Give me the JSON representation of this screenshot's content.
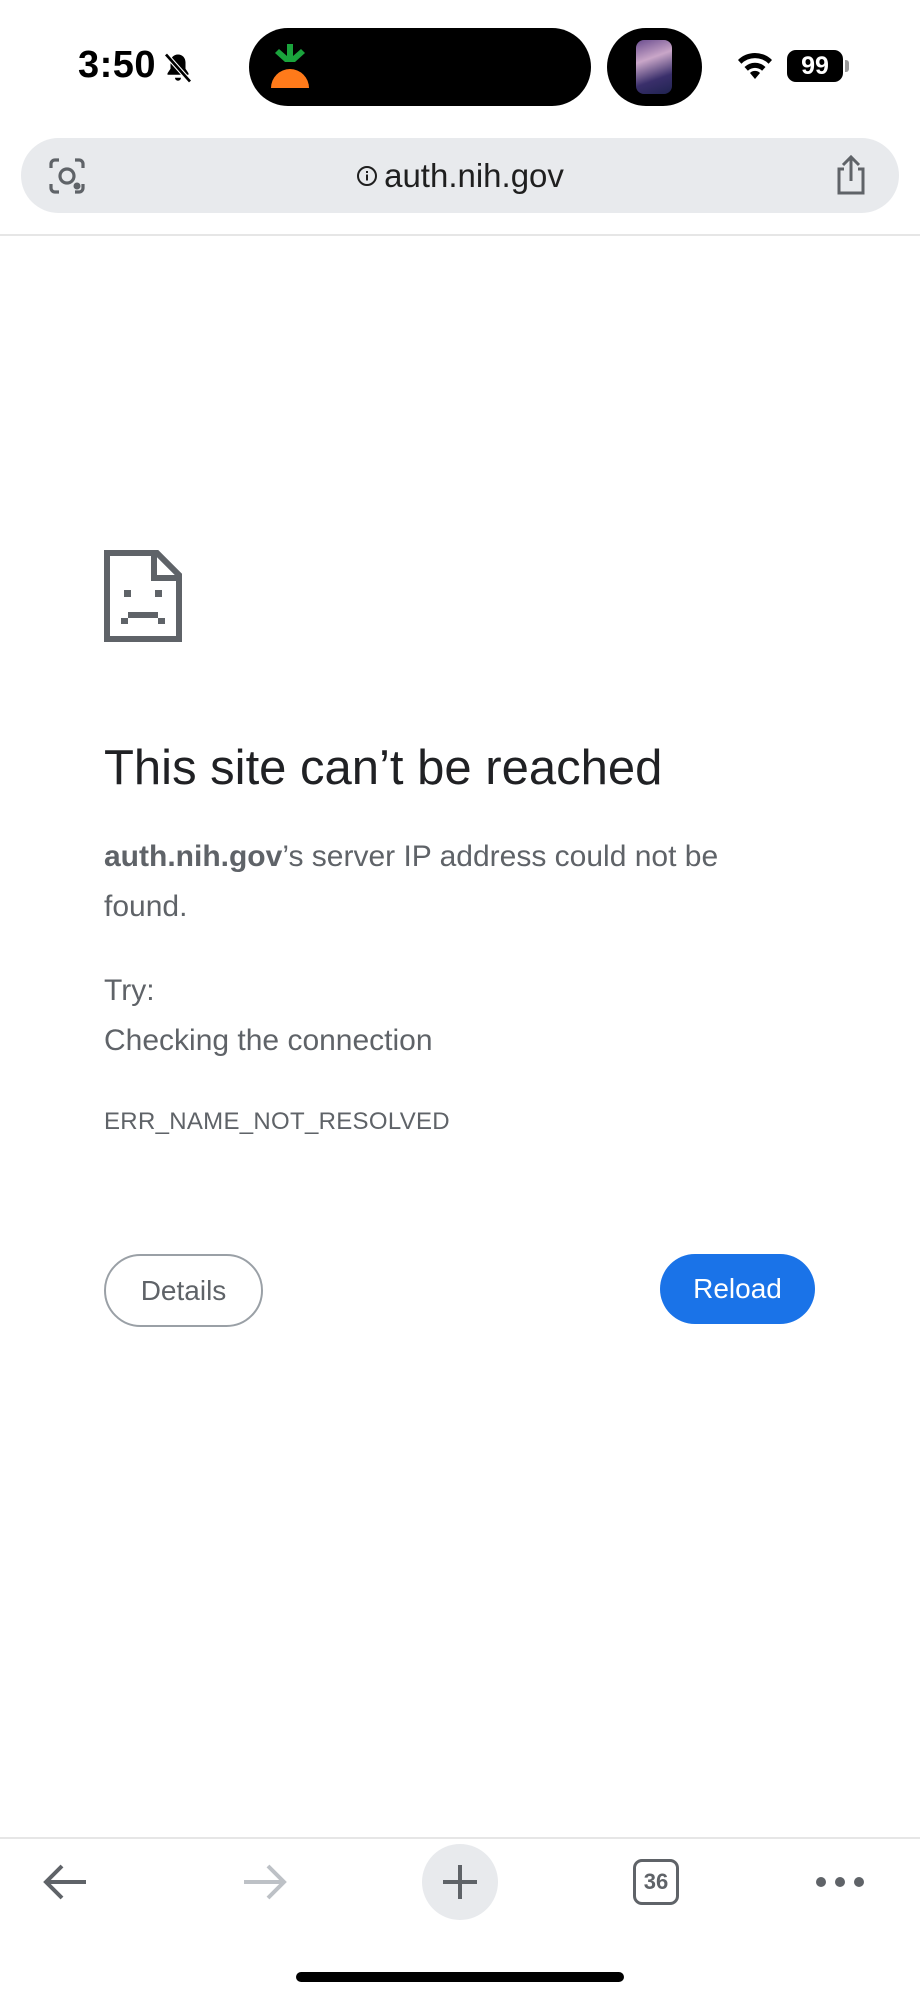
{
  "status_bar": {
    "time": "3:50",
    "battery": "99"
  },
  "url_bar": {
    "url": "auth.nih.gov"
  },
  "error": {
    "heading": "This site can’t be reached",
    "host": "auth.nih.gov",
    "message_rest": "’s server IP address could not be found.",
    "try_label": "Try:",
    "suggestion": "Checking the connection",
    "code": "ERR_NAME_NOT_RESOLVED",
    "details_label": "Details",
    "reload_label": "Reload"
  },
  "toolbar": {
    "tab_count": "36"
  },
  "colors": {
    "accent": "#1a73e8",
    "text_primary": "#202124",
    "text_secondary": "#5f6368",
    "url_bar_bg": "#e8eaed"
  },
  "icons": [
    "bell-slash-icon",
    "carrot-app-icon",
    "wifi-icon",
    "battery-icon",
    "lens-icon",
    "info-icon",
    "share-icon",
    "sad-page-icon",
    "back-arrow-icon",
    "forward-arrow-icon",
    "plus-icon",
    "tab-switcher-icon",
    "more-icon"
  ]
}
